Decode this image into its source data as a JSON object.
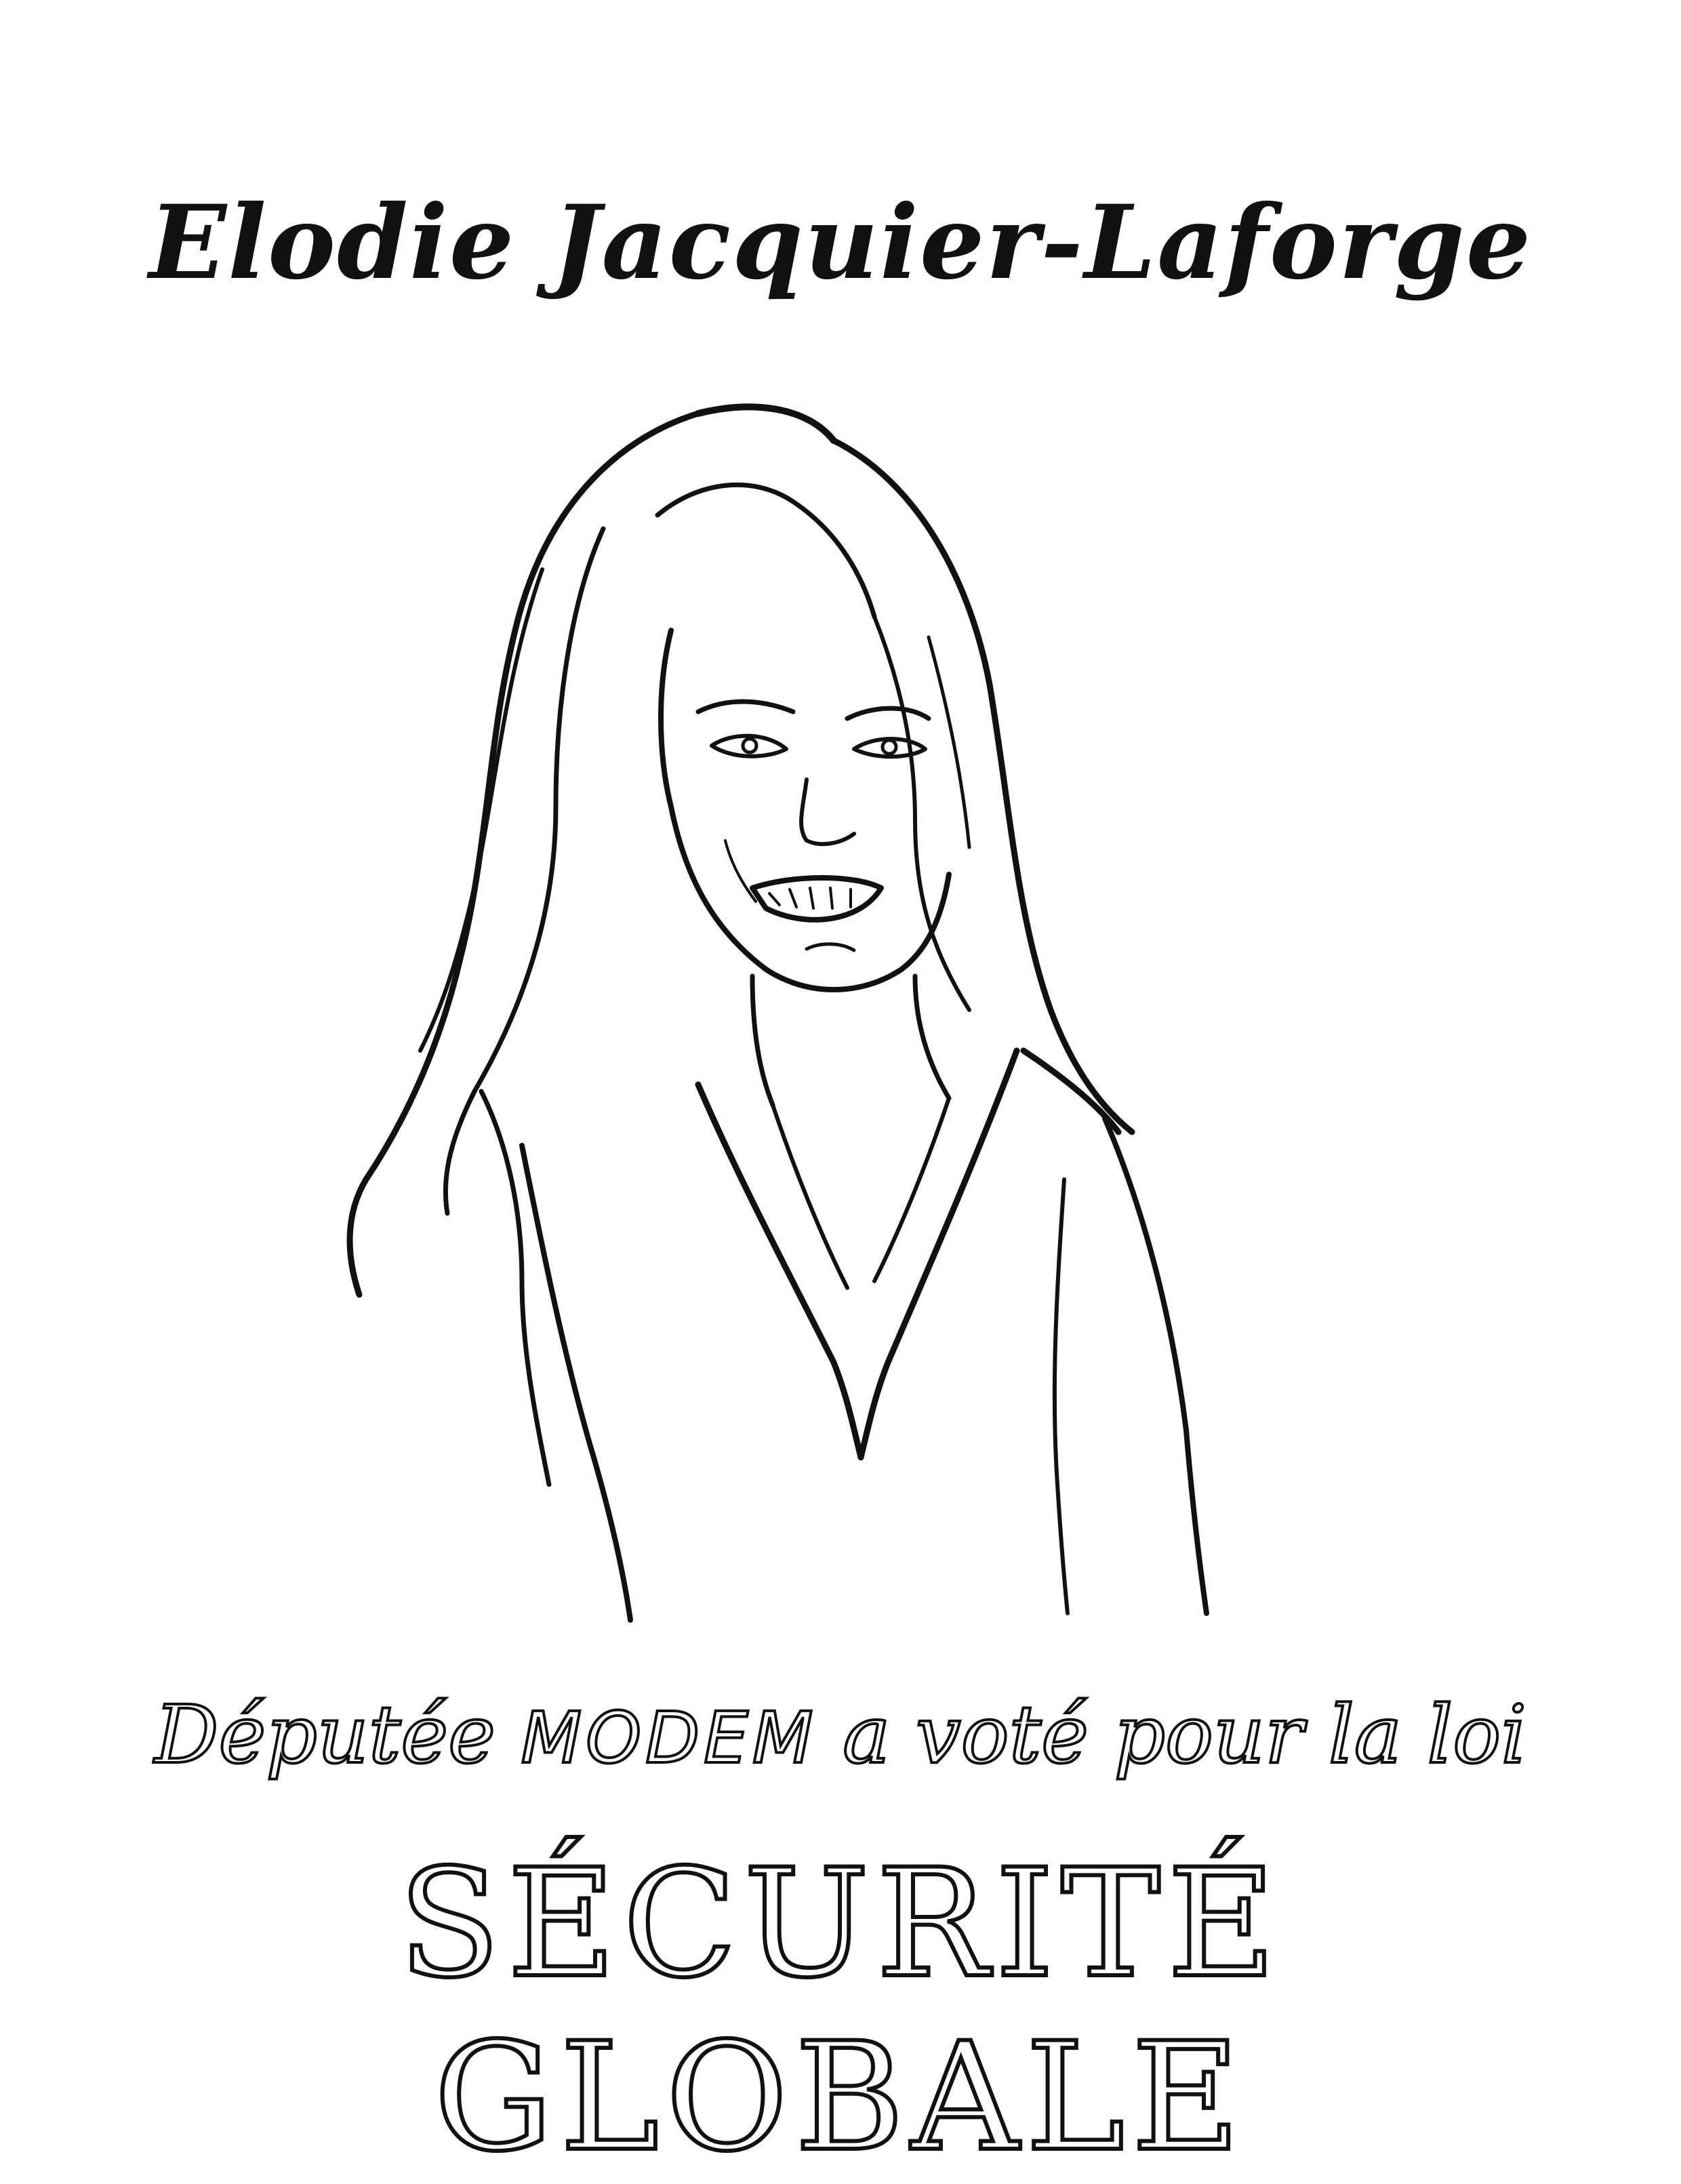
{
  "poster": {
    "name": "Elodie Jacquier-Laforge",
    "caption_before": "Députée ",
    "caption_party": "MODEM",
    "caption_after": " a voté pour la loi",
    "law_name": "SÉCURITÉ GLOBALE"
  },
  "colors": {
    "ink": "#111111",
    "paper": "#ffffff"
  }
}
